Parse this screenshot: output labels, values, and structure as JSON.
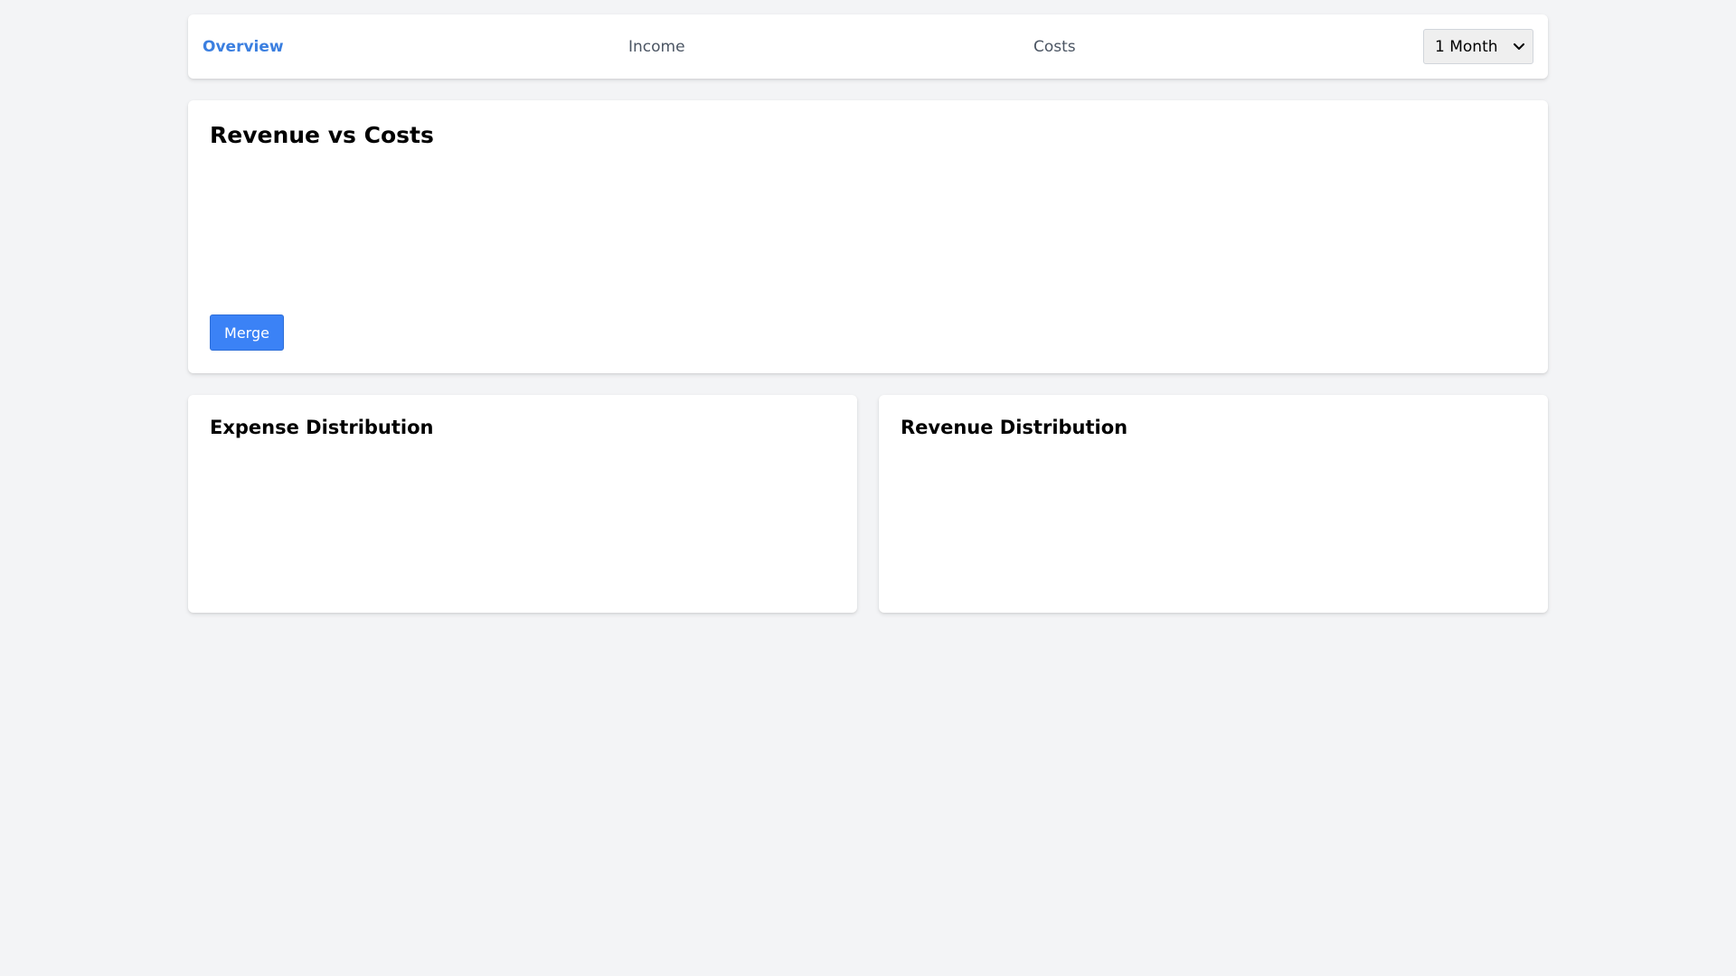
{
  "nav": {
    "tabs": [
      {
        "label": "Overview",
        "active": true
      },
      {
        "label": "Income",
        "active": false
      },
      {
        "label": "Costs",
        "active": false
      }
    ],
    "period": {
      "selected": "1 Month",
      "icon": "chevron-down-icon"
    }
  },
  "revenue_vs_costs": {
    "title": "Revenue vs Costs",
    "merge_label": "Merge"
  },
  "expense_distribution": {
    "title": "Expense Distribution"
  },
  "revenue_distribution": {
    "title": "Revenue Distribution"
  },
  "colors": {
    "accent": "#3b82f6",
    "active_tab": "#3b7fe0",
    "background": "#f3f4f6",
    "card": "#ffffff"
  }
}
